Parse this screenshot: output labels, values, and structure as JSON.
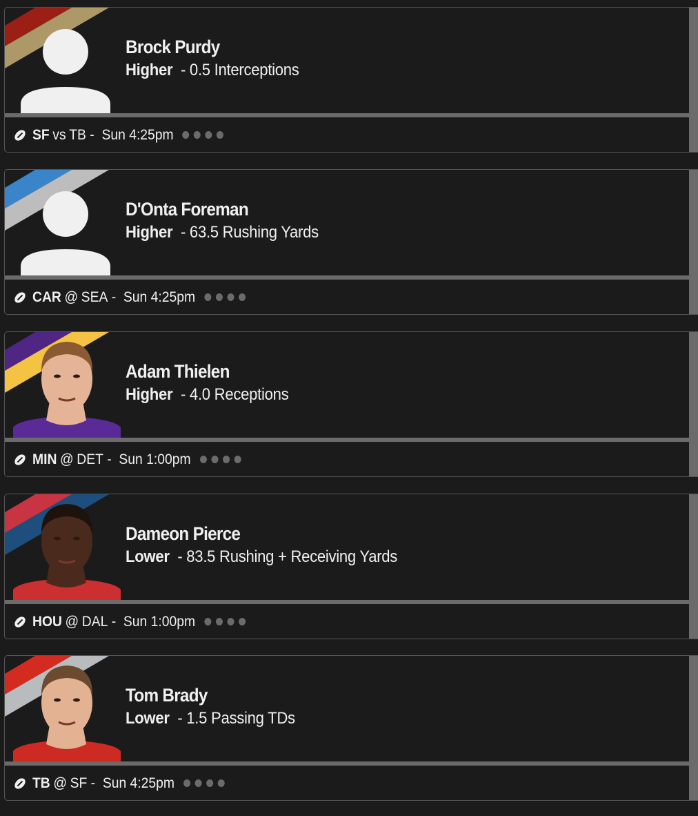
{
  "picks": [
    {
      "player": "Brock Purdy",
      "direction": "Higher",
      "line": "0.5",
      "stat": "Interceptions",
      "team": "SF",
      "separator": "vs",
      "opponent": "TB",
      "time": "Sun 4:25pm",
      "has_photo": false,
      "colors": {
        "stripe1": "#9b1f15",
        "stripe2": "#ad9868",
        "jersey": "#9b1f15",
        "skin": "#f0f0f0"
      }
    },
    {
      "player": "D'Onta Foreman",
      "direction": "Higher",
      "line": "63.5",
      "stat": "Rushing Yards",
      "team": "CAR",
      "separator": "@",
      "opponent": "SEA",
      "time": "Sun 4:25pm",
      "has_photo": false,
      "colors": {
        "stripe1": "#3a85c9",
        "stripe2": "#bdbdbd",
        "jersey": "#3a85c9",
        "skin": "#f0f0f0"
      }
    },
    {
      "player": "Adam Thielen",
      "direction": "Higher",
      "line": "4.0",
      "stat": "Receptions",
      "team": "MIN",
      "separator": "@",
      "opponent": "DET",
      "time": "Sun 1:00pm",
      "has_photo": true,
      "colors": {
        "stripe1": "#4f2683",
        "stripe2": "#f5c344",
        "jersey": "#5a2a96",
        "skin": "#e5b497",
        "hair": "#8a5a32"
      }
    },
    {
      "player": "Dameon Pierce",
      "direction": "Lower",
      "line": "83.5",
      "stat": "Rushing + Receiving Yards",
      "team": "HOU",
      "separator": "@",
      "opponent": "DAL",
      "time": "Sun 1:00pm",
      "has_photo": true,
      "colors": {
        "stripe1": "#c93442",
        "stripe2": "#1d4e7e",
        "jersey": "#cc2f2f",
        "skin": "#4a2a1c",
        "hair": "#1e120c"
      }
    },
    {
      "player": "Tom Brady",
      "direction": "Lower",
      "line": "1.5",
      "stat": "Passing TDs",
      "team": "TB",
      "separator": "@",
      "opponent": "SF",
      "time": "Sun 4:25pm",
      "has_photo": true,
      "colors": {
        "stripe1": "#d42b20",
        "stripe2": "#b8bcbf",
        "jersey": "#cc2a22",
        "skin": "#e3b293",
        "hair": "#6b4a30"
      }
    }
  ],
  "icons": {
    "football": "football-icon",
    "placeholder_avatar": "person-silhouette-icon"
  },
  "status_dots_count": 4
}
